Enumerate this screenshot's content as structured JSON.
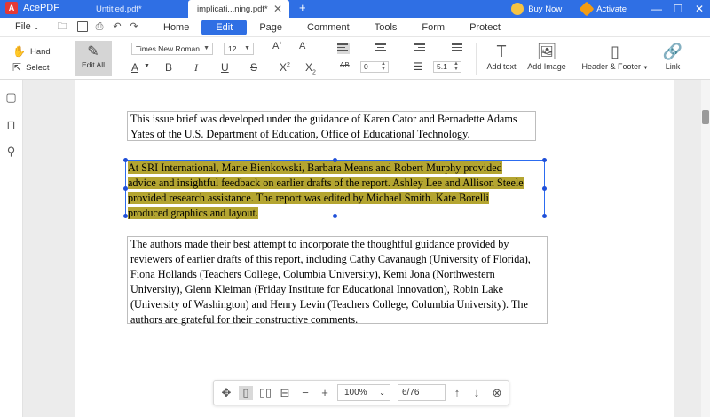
{
  "titlebar": {
    "app_name": "AcePDF",
    "tabs": [
      {
        "label": "Untitled.pdf*"
      },
      {
        "label": "implicati...ning.pdf*"
      }
    ],
    "new_tab": "+",
    "buy_now": "Buy Now",
    "activate": "Activate",
    "minimize": "—",
    "maximize": "☐",
    "close": "✕"
  },
  "menubar": {
    "file": "File",
    "main_tabs": [
      "Home",
      "Edit",
      "Page",
      "Comment",
      "Tools",
      "Form",
      "Protect"
    ],
    "active_tab": "Edit"
  },
  "toolbar": {
    "hand": "Hand",
    "select": "Select",
    "edit_all": "Edit All",
    "font_family": "Times New Roman",
    "font_size": "12",
    "char_spacing": "0",
    "line_spacing": "5.1",
    "add_text": "Add text",
    "add_image": "Add Image",
    "header_footer": "Header & Footer",
    "link": "Link",
    "char_spacing_label": "AB"
  },
  "document": {
    "para1": "This issue brief was developed under the guidance of Karen Cator and Bernadette Adams Yates of the U.S. Department of Education, Office of Educational Technology.",
    "para2_lines": [
      "At SRI International, Marie Bienkowski, Barbara Means and Robert Murphy provided",
      "advice and insightful feedback on earlier drafts of the report. Ashley Lee and Allison Steele",
      "provided research assistance. The report was edited by Michael Smith. Kate Borelli",
      "produced graphics and layout."
    ],
    "para3": "The authors made their best attempt to incorporate the thoughtful guidance provided by reviewers of earlier drafts of this report, including Cathy Cavanaugh (University of Florida), Fiona Hollands (Teachers College, Columbia University), Kemi Jona (Northwestern University), Glenn Kleiman (Friday Institute for Educational Innovation), Robin Lake (University of Washington) and Henry Levin (Teachers College, Columbia University). The authors are grateful for their constructive comments."
  },
  "bottombar": {
    "zoom": "100%",
    "page": "6/76"
  },
  "colors": {
    "accent": "#2f6fe4",
    "highlight": "#b4a531",
    "selection": "#2c6cf0"
  }
}
